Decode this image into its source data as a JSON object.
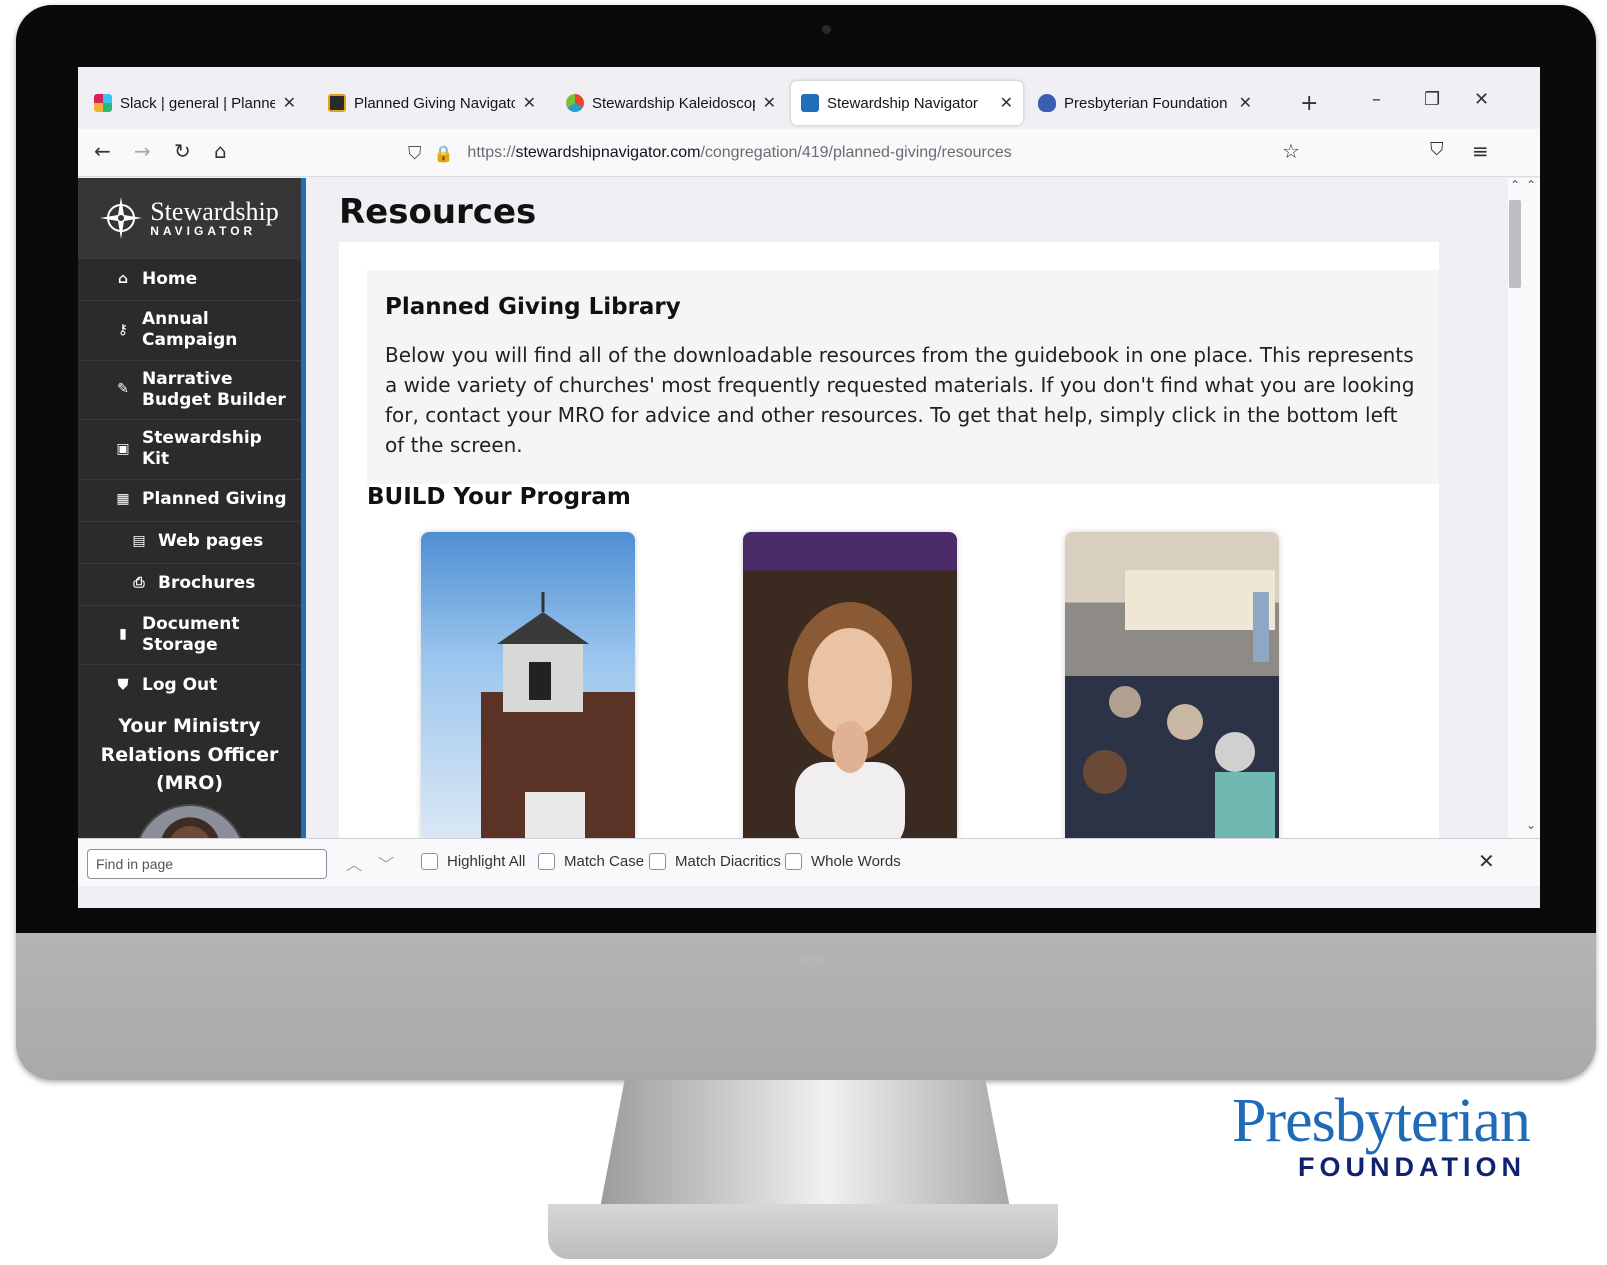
{
  "browser": {
    "tabs": [
      {
        "label": "Slack | general | Planned Givin",
        "favicon_color": "#e01e5a"
      },
      {
        "label": "Planned Giving Navigator Clie",
        "favicon_color": "#c2541a"
      },
      {
        "label": "Stewardship Kaleidoscope – F",
        "favicon_color": "#2aa0c8"
      },
      {
        "label": "Stewardship Navigator",
        "favicon_color": "#1e6fb8"
      },
      {
        "label": "Presbyterian Foundation",
        "favicon_color": "#3b5fb0"
      }
    ],
    "active_tab": 3,
    "url_domain": "stewardshipnavigator.com",
    "url_scheme": "https://",
    "url_path": "/congregation/419/planned-giving/resources"
  },
  "sidebar": {
    "brand_main": "Stewardship",
    "brand_sub": "NAVIGATOR",
    "items": [
      {
        "label": "Home",
        "icon": "home-icon",
        "glyph": "🏠"
      },
      {
        "label": "Annual Campaign",
        "icon": "key-icon",
        "glyph": "⚿"
      },
      {
        "label": "Narrative Budget Builder",
        "icon": "pencil-icon",
        "glyph": "✎"
      },
      {
        "label": "Stewardship Kit",
        "icon": "image-icon",
        "glyph": "▣"
      },
      {
        "label": "Planned Giving",
        "icon": "calendar-icon",
        "glyph": "▦"
      },
      {
        "label": "Web pages",
        "icon": "web-icon",
        "glyph": "▤"
      },
      {
        "label": "Brochures",
        "icon": "print-icon",
        "glyph": "⎙"
      },
      {
        "label": "Document Storage",
        "icon": "bookmark-icon",
        "glyph": "▮"
      },
      {
        "label": "Log Out",
        "icon": "shield-icon",
        "glyph": "⛊"
      }
    ],
    "mro_heading": "Your Ministry Relations Officer (MRO)"
  },
  "main": {
    "title": "Resources",
    "library": {
      "title": "Planned Giving Library",
      "text": "Below you will find all of the downloadable resources from the guidebook in one place. This represents a wide variety of churches' most frequently requested materials. If you don't find what you are looking for, contact your MRO for advice and other resources. To get that help, simply click in the bottom left of the screen."
    },
    "build_title": "BUILD Your Program"
  },
  "findbar": {
    "placeholder": "Find in page",
    "options": [
      "Highlight All",
      "Match Case",
      "Match Diacritics",
      "Whole Words"
    ]
  },
  "logo": {
    "main": "Presbyterian",
    "sub": "FOUNDATION"
  }
}
